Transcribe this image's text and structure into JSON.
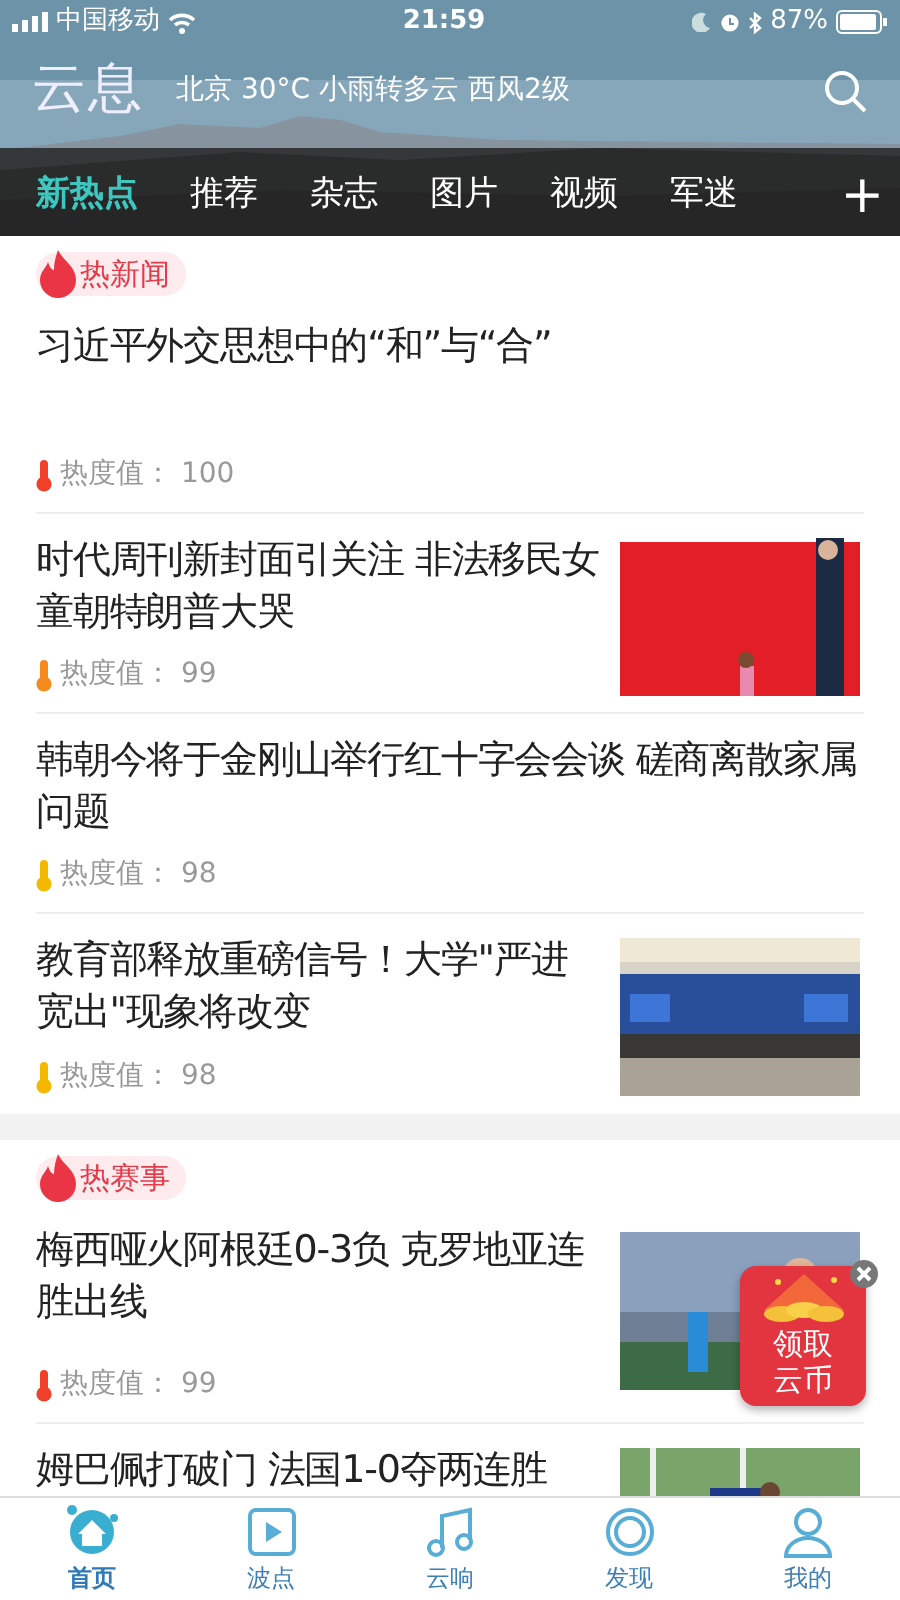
{
  "status_bar": {
    "carrier": "中国移动",
    "time": "21:59",
    "battery": "87%"
  },
  "header": {
    "logo": "云息",
    "weather": "北京 30°C 小雨转多云 西风2级"
  },
  "channels": [
    {
      "label": "新热点",
      "selected": true
    },
    {
      "label": "推荐",
      "selected": false
    },
    {
      "label": "杂志",
      "selected": false
    },
    {
      "label": "图片",
      "selected": false
    },
    {
      "label": "视频",
      "selected": false
    },
    {
      "label": "军迷",
      "selected": false
    }
  ],
  "add_channel": "+",
  "sections": [
    {
      "tag": "热新闻",
      "articles": [
        {
          "title": "习近平外交思想中的“和”与“合”",
          "heat_label": "热度值：",
          "heat": "100",
          "color": "#f0402a"
        },
        {
          "title": "时代周刊新封面引关注 非法移民女童朝特朗普大哭",
          "heat_label": "热度值：",
          "heat": "99",
          "color": "#f58a1e",
          "kind": "picture"
        },
        {
          "title": "韩朝今将于金刚山举行红十字会会谈 磋商离散家属问题",
          "heat_label": "热度值：",
          "heat": "98",
          "color": "#f5b800"
        },
        {
          "title": "教育部释放重磅信号！大学\"严进宽出\"现象将改变",
          "heat_label": "热度值：",
          "heat": "98",
          "color": "#f5b800",
          "kind": "picture"
        }
      ]
    },
    {
      "tag": "热赛事",
      "articles": [
        {
          "title": "梅西哑火阿根廷0-3负 克罗地亚连胜出线",
          "heat_label": "热度值：",
          "heat": "99",
          "color": "#f0402a",
          "kind": "picture"
        },
        {
          "title": "姆巴佩打破门 法国1-0夺两连胜",
          "kind": "picture"
        }
      ]
    }
  ],
  "reward": {
    "label": "领取云币"
  },
  "tabbar": [
    {
      "label": "首页",
      "selected": true,
      "kind": "home"
    },
    {
      "label": "波点",
      "selected": false,
      "kind": "play"
    },
    {
      "label": "云响",
      "selected": false,
      "kind": "music"
    },
    {
      "label": "发现",
      "selected": false,
      "kind": "discover"
    },
    {
      "label": "我的",
      "selected": false,
      "kind": "person"
    }
  ]
}
